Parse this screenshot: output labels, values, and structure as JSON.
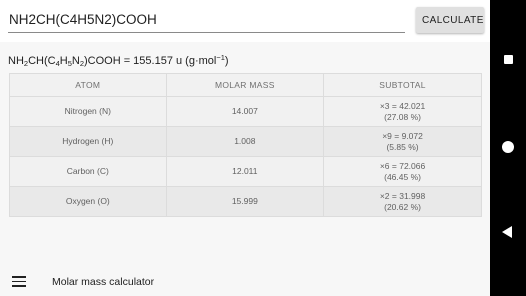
{
  "input": {
    "value": "NH2CH(C4H5N2)COOH"
  },
  "calculate_button": {
    "label": "CALCULATE"
  },
  "result": {
    "prefix": "NH",
    "s1": "2",
    "mid1": "CH(C",
    "s2": "4",
    "mid2": "H",
    "s3": "5",
    "mid3": "N",
    "s4": "2",
    "mid4": ")COOH = 155.157 u (g·mol",
    "sup": "−1",
    "suffix": ")"
  },
  "table": {
    "headers": [
      "ATOM",
      "MOLAR MASS",
      "SUBTOTAL"
    ],
    "rows": [
      {
        "atom": "Nitrogen (N)",
        "mass": "14.007",
        "sub1": "×3 = 42.021",
        "sub2": "(27.08 %)"
      },
      {
        "atom": "Hydrogen (H)",
        "mass": "1.008",
        "sub1": "×9 = 9.072",
        "sub2": "(5.85 %)"
      },
      {
        "atom": "Carbon (C)",
        "mass": "12.011",
        "sub1": "×6 = 72.066",
        "sub2": "(46.45 %)"
      },
      {
        "atom": "Oxygen (O)",
        "mass": "15.999",
        "sub1": "×2 = 31.998",
        "sub2": "(20.62 %)"
      }
    ]
  },
  "bottom_bar": {
    "title": "Molar mass calculator",
    "menu_icon": "hamburger-menu-icon"
  },
  "system_nav": {
    "recents": "square-icon",
    "home": "circle-icon",
    "back": "triangle-back-icon"
  }
}
